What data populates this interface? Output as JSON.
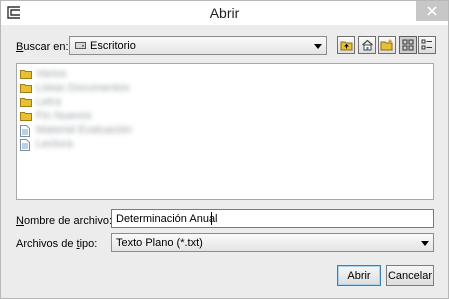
{
  "window": {
    "title": "Abrir"
  },
  "lookin": {
    "label_pre": "",
    "label_ul": "B",
    "label_post": "uscar en:",
    "value": "Escritorio"
  },
  "toolbar": [
    "up-one-level-icon",
    "desktop-home-icon",
    "new-folder-icon",
    "list-view-icon",
    "details-view-icon"
  ],
  "files": [
    {
      "kind": "folder",
      "name": "Varios"
    },
    {
      "kind": "folder",
      "name": "Listas Documentos"
    },
    {
      "kind": "folder",
      "name": "Letra"
    },
    {
      "kind": "folder",
      "name": "Fin Nuevos"
    },
    {
      "kind": "file",
      "name": "Material Evaluación"
    },
    {
      "kind": "file",
      "name": "Lectura"
    }
  ],
  "filename": {
    "label_pre": "",
    "label_ul": "N",
    "label_post": "ombre de archivo:",
    "value": "Determinación Anual"
  },
  "filetype": {
    "label_pre": "Archivos de ",
    "label_ul": "t",
    "label_post": "ipo:",
    "value": "Texto Plano (*.txt)"
  },
  "buttons": {
    "open": "Abrir",
    "cancel": "Cancelar"
  },
  "colors": {
    "folder": "#e8c034",
    "selected_toolbar": "#cfcfcf",
    "default_button_border": "#3c7fb1"
  }
}
